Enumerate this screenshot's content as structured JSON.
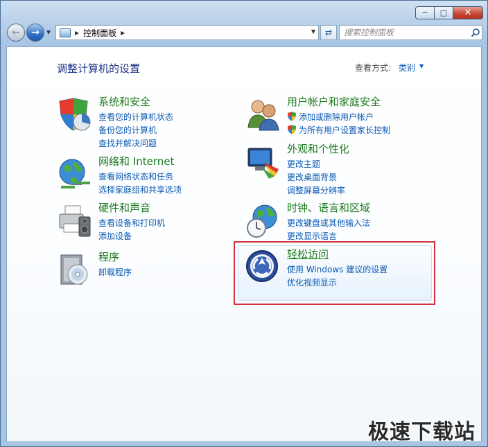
{
  "window": {
    "caption": {
      "minimize_glyph": "─",
      "maximize_glyph": "□",
      "close_glyph": "✕"
    }
  },
  "nav": {
    "address": {
      "breadcrumb": "控制面板"
    },
    "search": {
      "placeholder": "搜索控制面板"
    }
  },
  "content": {
    "title": "调整计算机的设置",
    "view_by_label": "查看方式:",
    "view_by_value": "类别"
  },
  "categories": [
    {
      "id": "system-security",
      "title": "系统和安全",
      "icon": "shield-pie-icon",
      "links": [
        "查看您的计算机状态",
        "备份您的计算机",
        "查找并解决问题"
      ]
    },
    {
      "id": "network-internet",
      "title": "网络和 Internet",
      "icon": "globe-network-icon",
      "links": [
        "查看网络状态和任务",
        "选择家庭组和共享选项"
      ]
    },
    {
      "id": "hardware-sound",
      "title": "硬件和声音",
      "icon": "printer-speaker-icon",
      "links": [
        "查看设备和打印机",
        "添加设备"
      ]
    },
    {
      "id": "programs",
      "title": "程序",
      "icon": "program-disc-icon",
      "links": [
        "卸载程序"
      ]
    },
    {
      "id": "user-accounts",
      "title": "用户帐户和家庭安全",
      "icon": "users-icon",
      "links": [
        "添加或删除用户帐户",
        "为所有用户设置家长控制"
      ]
    },
    {
      "id": "appearance",
      "title": "外观和个性化",
      "icon": "monitor-palette-icon",
      "links": [
        "更改主题",
        "更改桌面背景",
        "调整屏幕分辨率"
      ]
    },
    {
      "id": "clock-language",
      "title": "时钟、语言和区域",
      "icon": "globe-clock-icon",
      "links": [
        "更改键盘或其他输入法",
        "更改显示语言"
      ]
    },
    {
      "id": "ease-of-access",
      "title": "轻松访问",
      "icon": "ease-of-access-icon",
      "links": [
        "使用 Windows 建议的设置",
        "优化视频显示"
      ]
    }
  ],
  "watermark": "极速下载站",
  "colors": {
    "category_title": "#1c7a1c",
    "link": "#0b59b3",
    "page_title": "#1e3287",
    "highlight_border": "#d6303e"
  }
}
